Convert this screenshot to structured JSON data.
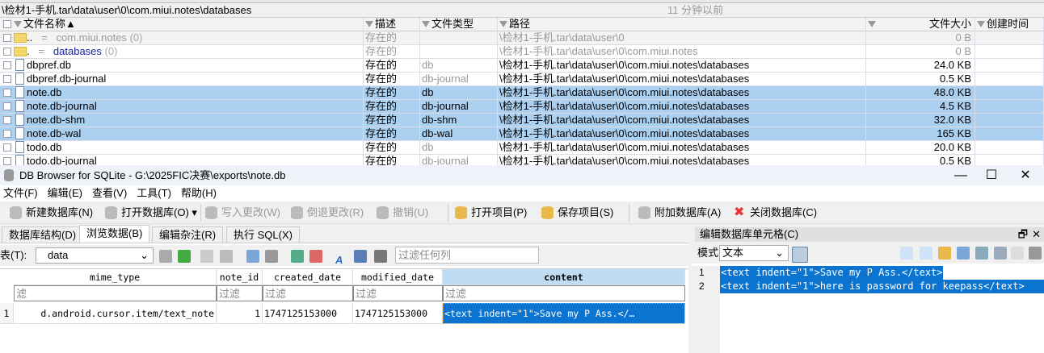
{
  "explorer": {
    "path": "\\检材1-手机.tar\\data\\user\\0\\com.miui.notes\\databases",
    "modified_ago": "11 分钟以前",
    "columns": [
      "文件名称",
      "描述",
      "文件类型",
      "路径",
      "文件大小",
      "创建时间"
    ],
    "rows": [
      {
        "name": "..",
        "eq": "=",
        "label": "com.miui.notes",
        "count": "(0)",
        "desc": "存在的",
        "type": "",
        "path": "\\检材1-手机.tar\\data\\user\\0",
        "size": "0 B"
      },
      {
        "name": ".",
        "eq": "=",
        "label": "databases",
        "count": "(0)",
        "desc": "存在的",
        "type": "",
        "path": "\\检材1-手机.tar\\data\\user\\0\\com.miui.notes",
        "size": "0 B"
      },
      {
        "name": "dbpref.db",
        "desc": "存在的",
        "type": "db",
        "path": "\\检材1-手机.tar\\data\\user\\0\\com.miui.notes\\databases",
        "size": "24.0 KB"
      },
      {
        "name": "dbpref.db-journal",
        "desc": "存在的",
        "type": "db-journal",
        "path": "\\检材1-手机.tar\\data\\user\\0\\com.miui.notes\\databases",
        "size": "0.5 KB"
      },
      {
        "name": "note.db",
        "desc": "存在的",
        "type": "db",
        "path": "\\检材1-手机.tar\\data\\user\\0\\com.miui.notes\\databases",
        "size": "48.0 KB"
      },
      {
        "name": "note.db-journal",
        "desc": "存在的",
        "type": "db-journal",
        "path": "\\检材1-手机.tar\\data\\user\\0\\com.miui.notes\\databases",
        "size": "4.5 KB"
      },
      {
        "name": "note.db-shm",
        "desc": "存在的",
        "type": "db-shm",
        "path": "\\检材1-手机.tar\\data\\user\\0\\com.miui.notes\\databases",
        "size": "32.0 KB"
      },
      {
        "name": "note.db-wal",
        "desc": "存在的",
        "type": "db-wal",
        "path": "\\检材1-手机.tar\\data\\user\\0\\com.miui.notes\\databases",
        "size": "165 KB"
      },
      {
        "name": "todo.db",
        "desc": "存在的",
        "type": "db",
        "path": "\\检材1-手机.tar\\data\\user\\0\\com.miui.notes\\databases",
        "size": "20.0 KB"
      },
      {
        "name": "todo.db-journal",
        "desc": "存在的",
        "type": "db-journal",
        "path": "\\检材1-手机.tar\\data\\user\\0\\com.miui.notes\\databases",
        "size": "0.5 KB"
      }
    ]
  },
  "window": {
    "title": "DB Browser for SQLite - G:\\2025FIC决赛\\exports\\note.db",
    "menu": [
      "文件(F)",
      "编辑(E)",
      "查看(V)",
      "工具(T)",
      "帮助(H)"
    ],
    "toolbar": [
      "新建数据库(N)",
      "打开数据库(O)",
      "写入更改(W)",
      "倒退更改(R)",
      "撤销(U)",
      "打开项目(P)",
      "保存项目(S)",
      "附加数据库(A)",
      "关闭数据库(C)"
    ],
    "tabs": [
      "数据库结构(D)",
      "浏览数据(B)",
      "编辑杂注(R)",
      "执行 SQL(X)"
    ],
    "table_label": "表(T):",
    "table_value": "data",
    "filter_all_placeholder": "过滤任何列",
    "grid": {
      "columns": [
        "mime_type",
        "note_id",
        "created_date",
        "modified_date",
        "content"
      ],
      "filter_placeholder": "过滤",
      "filter_first": "滤",
      "rows": [
        {
          "num": "1",
          "cells": [
            "d.android.cursor.item/text_note",
            "1",
            "1747125153000",
            "1747125153000",
            "<text indent=\"1\">Save my P Ass.</…"
          ]
        }
      ]
    },
    "editor": {
      "title": "编辑数据库单元格(C)",
      "mode_label": "模式:",
      "mode_value": "文本",
      "lines": [
        {
          "n": "1",
          "text": "<text indent=\"1\">Save my P Ass.</text>"
        },
        {
          "n": "2",
          "text": "<text indent=\"1\">here is password for keepass</text>"
        }
      ]
    }
  }
}
